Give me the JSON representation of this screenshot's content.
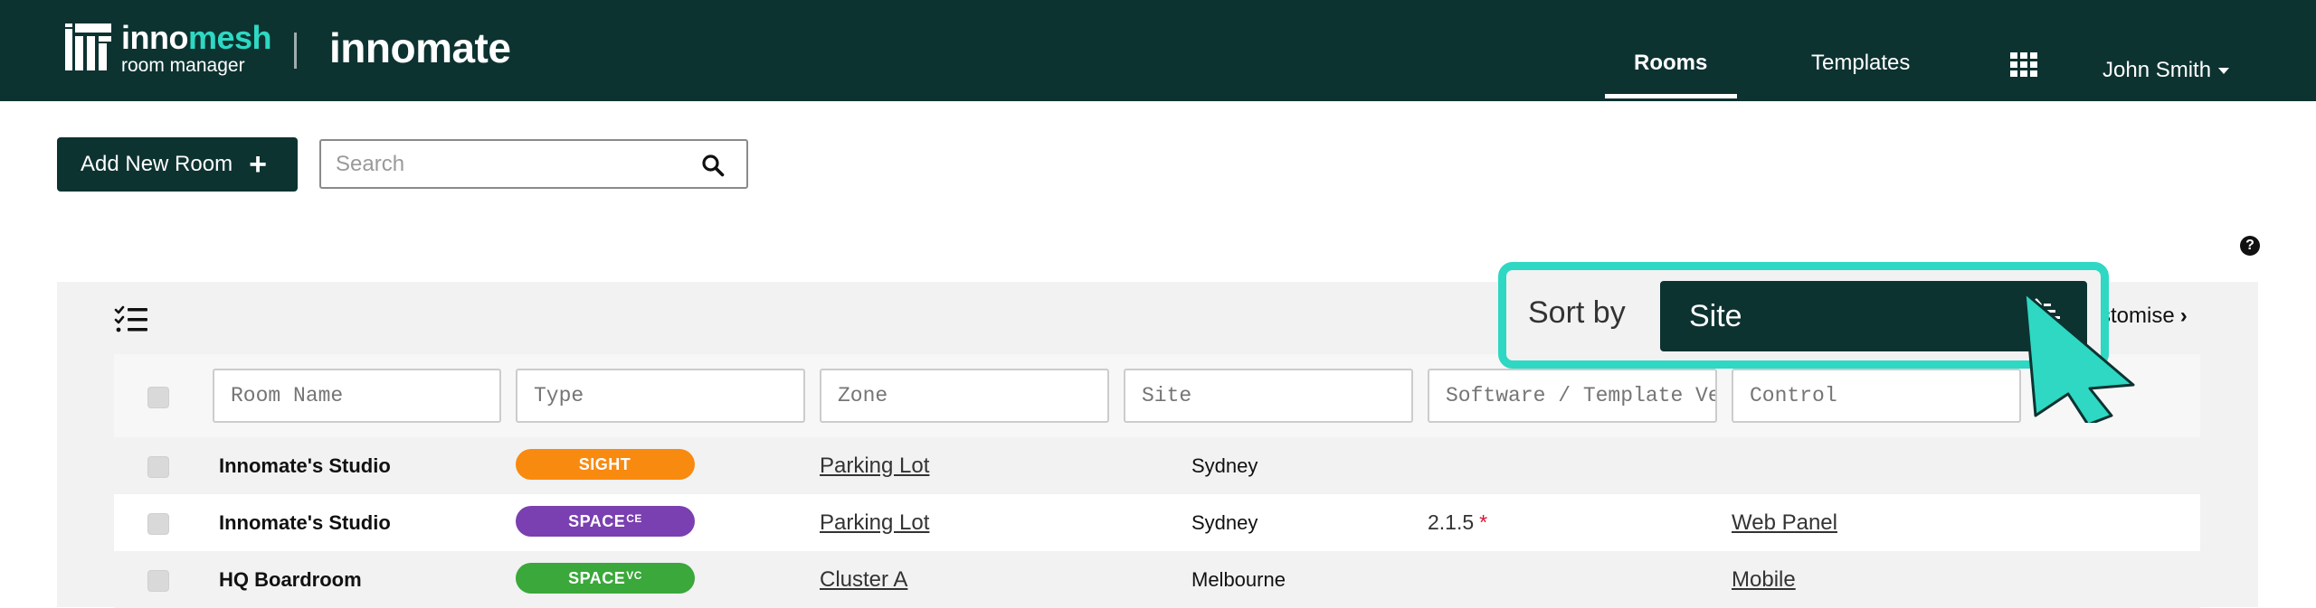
{
  "header": {
    "logo_brand_a": "inno",
    "logo_brand_b": "mesh",
    "logo_sub": "room manager",
    "product": "innomate",
    "nav": {
      "rooms": "Rooms",
      "templates": "Templates"
    },
    "user": "John Smith",
    "apps_icon": "grid-icon"
  },
  "toolbar": {
    "add_label": "Add New Room",
    "add_icon": "+",
    "search_placeholder": "Search",
    "help_icon": "?"
  },
  "panel": {
    "customise_label": "stomise",
    "customise_chevron": "›",
    "sort": {
      "label": "Sort by",
      "value": "Site"
    }
  },
  "filters": {
    "room_name": "Room Name",
    "type": "Type",
    "zone": "Zone",
    "site": "Site",
    "software": "Software / Template Version",
    "control": "Control"
  },
  "rows": [
    {
      "name": "Innomate's Studio",
      "type": "SIGHT",
      "type_sup": "",
      "type_color": "#f98a10",
      "zone": "Parking Lot",
      "site": "Sydney",
      "software": "",
      "software_flag": "",
      "control": ""
    },
    {
      "name": "Innomate's Studio",
      "type": "SPACE",
      "type_sup": "CE",
      "type_color": "#7a3fb0",
      "zone": "Parking Lot",
      "site": "Sydney",
      "software": "2.1.5",
      "software_flag": "*",
      "control": "Web Panel"
    },
    {
      "name": "HQ Boardroom",
      "type": "SPACE",
      "type_sup": "VC",
      "type_color": "#3aa83a",
      "zone": "Cluster A",
      "site": "Melbourne",
      "software": "",
      "software_flag": "",
      "control": "Mobile"
    }
  ],
  "colors": {
    "header_bg": "#0d3331",
    "accent": "#2ed8c3",
    "panel_bg": "#f2f2f2"
  }
}
